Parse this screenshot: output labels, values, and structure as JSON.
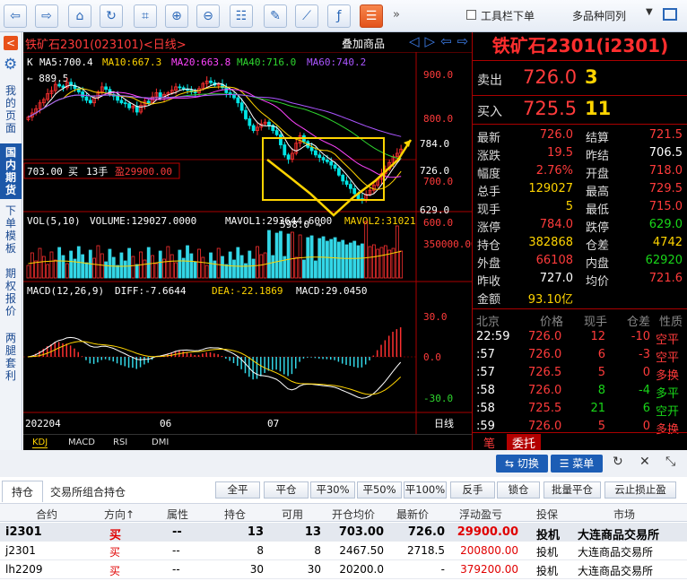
{
  "toolbar": {
    "more": "»",
    "checkbox_label": "工具栏下单",
    "same_variety": "多品种同列",
    "buttons": [
      "back-icon",
      "forward-icon",
      "home-icon",
      "refresh-icon",
      "crop-icon",
      "zoom-in-icon",
      "zoom-out-icon",
      "indicator-icon",
      "draw-pen-icon",
      "draw-line-icon",
      "function-icon",
      "list-icon"
    ]
  },
  "sidebar": {
    "items": [
      {
        "label": "我的页面"
      },
      {
        "label": "国内期货",
        "active": true
      },
      {
        "label": "下单模板"
      },
      {
        "label": "期权报价"
      },
      {
        "label": "两腿套利"
      }
    ]
  },
  "chart": {
    "title": "铁矿石2301(023101)<日线>",
    "overlay": "叠加商品",
    "ma_line": {
      "k": "K",
      "ma5": "MA5:700.4",
      "ma10": "MA10:667.3",
      "ma20": "MA20:663.8",
      "ma40": "MA40:716.0",
      "ma60": "MA60:740.2"
    },
    "high_mark": "← 889.5",
    "low_mark": "598.0 →",
    "position_tag": {
      "open": "703.00",
      "side": "买",
      "lots": "13手",
      "pnl": "盈29900.00"
    },
    "price_axis": [
      "900.0",
      "800.0",
      "784.0",
      "726.0",
      "700.0",
      "629.0",
      "600.0"
    ],
    "vol_line": {
      "title": "VOL(5,10)",
      "volume": "VOLUME:129027.0000",
      "mavol1": "MAVOL1:293644.6000",
      "mavol2": "MAVOL2:31021"
    },
    "vol_axis": "350000.00",
    "macd_line": {
      "title": "MACD(12,26,9)",
      "diff": "DIFF:-7.6644",
      "dea": "DEA:-22.1869",
      "macd": "MACD:29.0450"
    },
    "macd_axis": [
      "30.0",
      "0.0",
      "-30.0"
    ],
    "dates": [
      "202204",
      "06",
      "07"
    ],
    "period": "日线",
    "tabs": [
      "KDJ",
      "MACD",
      "RSI",
      "DMI"
    ]
  },
  "quote": {
    "title": "铁矿石2301(i2301)",
    "sell": {
      "label": "卖出",
      "price": "726.0",
      "vol": "3"
    },
    "buy": {
      "label": "买入",
      "price": "725.5",
      "vol": "11"
    },
    "rows": [
      {
        "l1": "最新",
        "v1": "726.0",
        "c1": "r",
        "l2": "结算",
        "v2": "721.5",
        "c2": "r"
      },
      {
        "l1": "涨跌",
        "v1": "19.5",
        "c1": "r",
        "l2": "昨结",
        "v2": "706.5",
        "c2": "w"
      },
      {
        "l1": "幅度",
        "v1": "2.76%",
        "c1": "r",
        "l2": "开盘",
        "v2": "718.0",
        "c2": "r"
      },
      {
        "l1": "总手",
        "v1": "129027",
        "c1": "y",
        "l2": "最高",
        "v2": "729.5",
        "c2": "r"
      },
      {
        "l1": "现手",
        "v1": "5",
        "c1": "y",
        "l2": "最低",
        "v2": "715.0",
        "c2": "r"
      },
      {
        "l1": "涨停",
        "v1": "784.0",
        "c1": "r",
        "l2": "跌停",
        "v2": "629.0",
        "c2": "g"
      },
      {
        "l1": "持仓",
        "v1": "382868",
        "c1": "y",
        "l2": "仓差",
        "v2": "4742",
        "c2": "y"
      },
      {
        "l1": "外盘",
        "v1": "66108",
        "c1": "r",
        "l2": "内盘",
        "v2": "62920",
        "c2": "g"
      },
      {
        "l1": "昨收",
        "v1": "727.0",
        "c1": "w",
        "l2": "均价",
        "v2": "721.6",
        "c2": "r"
      },
      {
        "l1": "金额",
        "v1": "93.10亿",
        "c1": "y",
        "l2": "",
        "v2": "",
        "c2": "w"
      }
    ],
    "tick_header": {
      "place": "北京",
      "price": "价格",
      "vol": "现手",
      "oi": "仓差",
      "nature": "性质"
    },
    "ticks": [
      {
        "time": "22:59",
        "price": "726.0",
        "vol": "12",
        "oi": "-10",
        "nature": "空平",
        "vc": "r",
        "oc": "r",
        "nc": "r"
      },
      {
        "time": ":57",
        "price": "726.0",
        "vol": "6",
        "oi": "-3",
        "nature": "空平",
        "vc": "r",
        "oc": "r",
        "nc": "r"
      },
      {
        "time": ":57",
        "price": "726.5",
        "vol": "5",
        "oi": "0",
        "nature": "多换",
        "vc": "r",
        "oc": "r",
        "nc": "r"
      },
      {
        "time": ":58",
        "price": "726.0",
        "vol": "8",
        "oi": "-4",
        "nature": "多平",
        "vc": "g",
        "oc": "g",
        "nc": "g"
      },
      {
        "time": ":58",
        "price": "725.5",
        "vol": "21",
        "oi": "6",
        "nature": "空开",
        "vc": "g",
        "oc": "g",
        "nc": "g"
      },
      {
        "time": ":59",
        "price": "726.0",
        "vol": "5",
        "oi": "0",
        "nature": "多换",
        "vc": "r",
        "oc": "r",
        "nc": "r"
      }
    ],
    "tabs": [
      "笔",
      "委托"
    ]
  },
  "controls": {
    "switch": "切换",
    "menu": "菜单"
  },
  "bottom": {
    "tabs": [
      "持仓",
      "交易所组合持仓"
    ],
    "actions": [
      "全平",
      "平仓",
      "平30%",
      "平50%",
      "平100%",
      "反手",
      "锁仓",
      "批量平仓",
      "云止损止盈"
    ],
    "headers": [
      "合约",
      "方向↑",
      "属性",
      "持仓",
      "可用",
      "开仓均价",
      "最新价",
      "浮动盈亏",
      "投保",
      "市场"
    ],
    "rows": [
      {
        "contract": "i2301",
        "dir": "买",
        "attr": "--",
        "pos": "13",
        "avail": "13",
        "avg": "703.00",
        "last": "726.0",
        "pnl": "29900.00",
        "hedge": "投机",
        "market": "大连商品交易所"
      },
      {
        "contract": "j2301",
        "dir": "买",
        "attr": "--",
        "pos": "8",
        "avail": "8",
        "avg": "2467.50",
        "last": "2718.5",
        "pnl": "200800.00",
        "hedge": "投机",
        "market": "大连商品交易所"
      },
      {
        "contract": "lh2209",
        "dir": "买",
        "attr": "--",
        "pos": "30",
        "avail": "30",
        "avg": "20200.0",
        "last": "-",
        "pnl": "379200.00",
        "hedge": "投机",
        "market": "大连商品交易所"
      }
    ]
  },
  "chart_data": {
    "type": "candlestick",
    "symbol": "铁矿石2301",
    "period": "日线",
    "price_high": 889.5,
    "price_low": 598.0,
    "last": 726.0,
    "limit_up": 784.0,
    "limit_down": 629.0,
    "ma": {
      "MA5": 700.4,
      "MA10": 667.3,
      "MA20": 663.8,
      "MA40": 716.0,
      "MA60": 740.2
    },
    "volume": {
      "VOLUME": 129027.0,
      "MAVOL1": 293644.6
    },
    "macd": {
      "DIFF": -7.6644,
      "DEA": -22.1869,
      "MACD": 29.045
    },
    "close_series": [
      802,
      812,
      822,
      836,
      844,
      858,
      865,
      880,
      876,
      872,
      885,
      878,
      870,
      862,
      850,
      842,
      836,
      848,
      862,
      874,
      868,
      856,
      852,
      842,
      836,
      834,
      824,
      828,
      814,
      830,
      840,
      836,
      850,
      860,
      848,
      856,
      860,
      866,
      874,
      872,
      868,
      866,
      862,
      860,
      870,
      882,
      888,
      884,
      878,
      880,
      872,
      860,
      856,
      848,
      836,
      818,
      798,
      782,
      770,
      778,
      786,
      790,
      782,
      770,
      760,
      736,
      712,
      702,
      716,
      740,
      758,
      744,
      730,
      722,
      712,
      706,
      700,
      696,
      688,
      680,
      664,
      650,
      642,
      632,
      620,
      608,
      606,
      618,
      628,
      640,
      654,
      668,
      678,
      694,
      708,
      716,
      726
    ]
  }
}
